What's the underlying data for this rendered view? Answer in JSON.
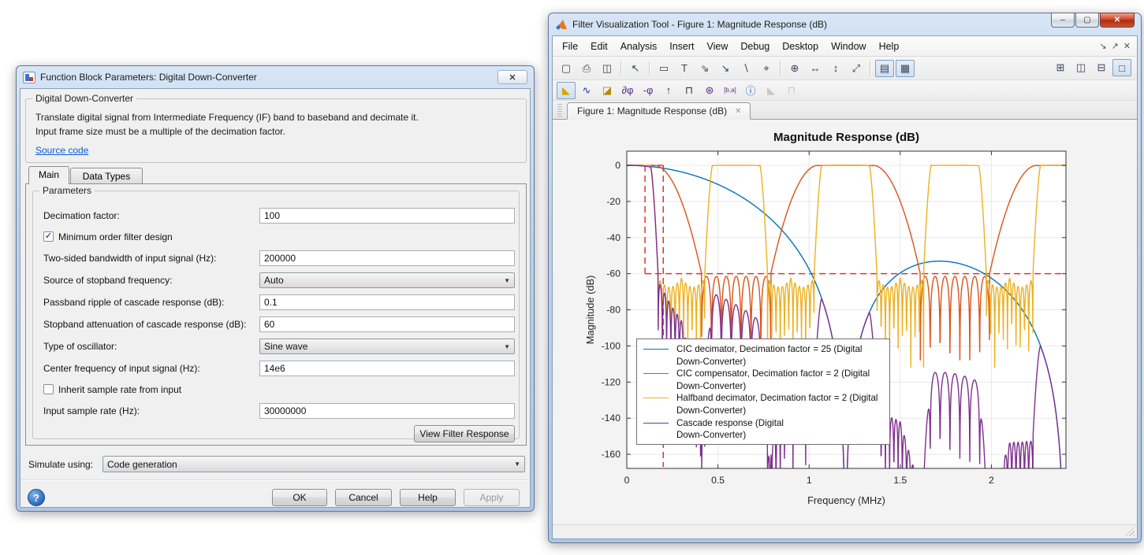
{
  "ui": {
    "arrow_down": "▼",
    "check": "✓",
    "help_glyph": "?"
  },
  "dialog": {
    "title": "Function Block Parameters: Digital Down-Converter",
    "close_glyph": "✕",
    "heading": "Digital Down-Converter",
    "desc1": "Translate digital signal from Intermediate Frequency (IF) band to baseband and decimate it.",
    "desc2": "Input frame size must be a multiple of the decimation factor.",
    "source_link": "Source code",
    "tabs": [
      {
        "label": "Main"
      },
      {
        "label": "Data Types"
      }
    ],
    "params_group": "Parameters",
    "rows": {
      "decimation": {
        "label": "Decimation factor:",
        "value": "100"
      },
      "min_order": {
        "label": "Minimum order filter design",
        "checked": true
      },
      "bandwidth": {
        "label": "Two-sided bandwidth of input signal (Hz):",
        "value": "200000"
      },
      "stopband_src": {
        "label": "Source of stopband frequency:",
        "value": "Auto"
      },
      "ripple": {
        "label": "Passband ripple of cascade response (dB):",
        "value": "0.1"
      },
      "atten": {
        "label": "Stopband attenuation of cascade response (dB):",
        "value": "60"
      },
      "oscillator": {
        "label": "Type of oscillator:",
        "value": "Sine wave"
      },
      "center_freq": {
        "label": "Center frequency of input signal (Hz):",
        "value": "14e6"
      },
      "inherit": {
        "label": "Inherit sample rate from input",
        "checked": false
      },
      "sample_rate": {
        "label": "Input sample rate (Hz):",
        "value": "30000000"
      }
    },
    "view_filter_button": "View Filter Response",
    "simulate_label": "Simulate using:",
    "simulate_value": "Code generation",
    "ok": "OK",
    "cancel": "Cancel",
    "help": "Help",
    "apply": "Apply"
  },
  "fvtool": {
    "title": "Filter Visualization Tool - Figure 1: Magnitude Response (dB)",
    "window_controls": [
      {
        "name": "minimize-button",
        "glyph": "–"
      },
      {
        "name": "maximize-button",
        "glyph": "▢"
      },
      {
        "name": "close-button",
        "glyph": "✕",
        "state": "close"
      }
    ],
    "menus": [
      {
        "name": "menu-file",
        "label": "File"
      },
      {
        "name": "menu-edit",
        "label": "Edit"
      },
      {
        "name": "menu-analysis",
        "label": "Analysis"
      },
      {
        "name": "menu-insert",
        "label": "Insert"
      },
      {
        "name": "menu-view",
        "label": "View"
      },
      {
        "name": "menu-debug",
        "label": "Debug"
      },
      {
        "name": "menu-desktop",
        "label": "Desktop"
      },
      {
        "name": "menu-window",
        "label": "Window"
      },
      {
        "name": "menu-help",
        "label": "Help"
      }
    ],
    "menu_corner": [
      {
        "name": "dock-figure-icon",
        "glyph": "↘"
      },
      {
        "name": "undock-icon",
        "glyph": "↗"
      },
      {
        "name": "menubar-close-icon",
        "glyph": "✕"
      }
    ],
    "toolbar1": [
      {
        "name": "new-figure-icon",
        "glyph": "▢"
      },
      {
        "name": "print-icon",
        "glyph": "⎙"
      },
      {
        "name": "print-preview-icon",
        "glyph": "◫"
      },
      {
        "sep": true
      },
      {
        "name": "pointer-icon",
        "glyph": "↖"
      },
      {
        "sep": true
      },
      {
        "name": "edit-plot-icon",
        "glyph": "▭"
      },
      {
        "name": "insert-text-icon",
        "glyph": "T"
      },
      {
        "name": "insert-double-arrow-icon",
        "glyph": "⇘"
      },
      {
        "name": "insert-arrow-icon",
        "glyph": "↘"
      },
      {
        "name": "insert-line-icon",
        "glyph": "∖"
      },
      {
        "name": "pin-icon",
        "glyph": "⌖"
      },
      {
        "sep": true
      },
      {
        "name": "zoom-in-icon",
        "glyph": "⊕"
      },
      {
        "name": "zoom-x-icon",
        "glyph": "↔"
      },
      {
        "name": "zoom-y-icon",
        "glyph": "↕"
      },
      {
        "name": "restore-view-icon",
        "glyph": "⤢"
      },
      {
        "sep": true
      },
      {
        "name": "legend-toggle-icon",
        "glyph": "▤",
        "state": "pressed"
      },
      {
        "name": "grid-toggle-icon",
        "glyph": "▦",
        "state": "pressed"
      }
    ],
    "toolbar1_right": [
      {
        "name": "layout-grid-icon",
        "glyph": "⊞"
      },
      {
        "name": "layout-columns-icon",
        "glyph": "◫"
      },
      {
        "name": "layout-rows-icon",
        "glyph": "⊟"
      },
      {
        "name": "layout-single-icon",
        "glyph": "□",
        "state": "pressed"
      }
    ],
    "toolbar2": [
      {
        "name": "magnitude-response-icon",
        "glyph": "◣",
        "color": "#d9a400",
        "state": "pressed"
      },
      {
        "name": "phase-response-icon",
        "glyph": "∿",
        "color": "#2b2bb0"
      },
      {
        "name": "mag-phase-response-icon",
        "glyph": "◪",
        "color": "#b08c00"
      },
      {
        "name": "group-delay-icon",
        "glyph": "∂φ",
        "color": "#5b2d8e"
      },
      {
        "name": "phase-delay-icon",
        "glyph": "-φ",
        "color": "#5b2d8e"
      },
      {
        "name": "impulse-response-icon",
        "glyph": "↑",
        "color": "#333333"
      },
      {
        "name": "step-response-icon",
        "glyph": "⊓",
        "color": "#333333"
      },
      {
        "name": "pole-zero-icon",
        "glyph": "⊛",
        "color": "#5b2d8e"
      },
      {
        "name": "coefficients-icon",
        "glyph": "[b,a]",
        "color": "#5b2d8e",
        "small": true
      },
      {
        "name": "filter-info-icon",
        "glyph": "ⓘ",
        "color": "#1155cc"
      },
      {
        "name": "overlay-analysis-icon",
        "glyph": "◣",
        "color": "#999999",
        "state": "disabled",
        "interactable": "false"
      },
      {
        "name": "round-quantize-icon",
        "glyph": "⊓",
        "color": "#999999",
        "state": "disabled",
        "interactable": "false"
      }
    ],
    "figure_tab": {
      "label": "Figure 1: Magnitude Response (dB)",
      "close_glyph": "✕"
    }
  },
  "chart_data": {
    "type": "line",
    "title": "Magnitude Response (dB)",
    "xlabel": "Frequency (MHz)",
    "ylabel": "Magnitude (dB)",
    "xlim": [
      0,
      2.409
    ],
    "ylim": [
      -167.8,
      7.85
    ],
    "xticks": [
      0,
      0.5,
      1,
      1.5,
      2
    ],
    "yticks": [
      0,
      -20,
      -40,
      -60,
      -80,
      -100,
      -120,
      -140,
      -160
    ],
    "grid": true,
    "legend_position": "southwest-inside",
    "series": [
      {
        "name": "CIC decimator, Decimation factor = 25 (Digital Down-Converter)",
        "color": "#0072BD",
        "model": {
          "kind": "cic",
          "null1": 1.2,
          "sections": 4,
          "floor": -185
        }
      },
      {
        "name": "CIC compensator, Decimation factor = 2 (Digital Down-Converter)",
        "color": "#D95319",
        "model": {
          "kind": "periodic",
          "period": 1.2,
          "flat": 0.15,
          "stop": 0.41,
          "trans_pow": 2,
          "trans_db": 60,
          "sbPeak": -61.5,
          "lobes": 3.5,
          "notch": 25,
          "env": 0,
          "floor": -108
        }
      },
      {
        "name": "Halfband decimator, Decimation factor = 2 (Digital Down-Converter)",
        "color": "#EDB120",
        "model": {
          "kind": "periodic",
          "period": 0.6,
          "flat": 0.13,
          "stop": 0.172,
          "trans_pow": 1.5,
          "trans_db": 60,
          "sbPeak": -62.5,
          "lobes": 5.5,
          "notch": 22,
          "env": 5,
          "floor": -112
        }
      },
      {
        "name": "Cascade response (Digital Down-Converter)",
        "color": "#7E2F8E",
        "model": {
          "kind": "cascade",
          "of": [
            0,
            1,
            2
          ],
          "floor": -178
        }
      }
    ],
    "mask": {
      "color": "#e0352b",
      "dash": [
        8,
        5
      ],
      "segments": [
        [
          [
            0,
            0
          ],
          [
            0.2,
            0
          ]
        ],
        [
          [
            0.1,
            0
          ],
          [
            0.1,
            -60
          ]
        ],
        [
          [
            0.2,
            0
          ],
          [
            0.2,
            -167
          ]
        ],
        [
          [
            0.1,
            -60
          ],
          [
            2.409,
            -60
          ]
        ]
      ]
    },
    "legend": [
      {
        "line1": "CIC decimator, Decimation factor = 25 (Digital",
        "line2": "Down-Converter)"
      },
      {
        "line1": "CIC compensator, Decimation factor = 2 (Digital",
        "line2": "Down-Converter)"
      },
      {
        "line1": "Halfband decimator, Decimation factor = 2 (Digital",
        "line2": "Down-Converter)"
      },
      {
        "line1": "Cascade response (Digital",
        "line2": "Down-Converter)"
      }
    ]
  }
}
